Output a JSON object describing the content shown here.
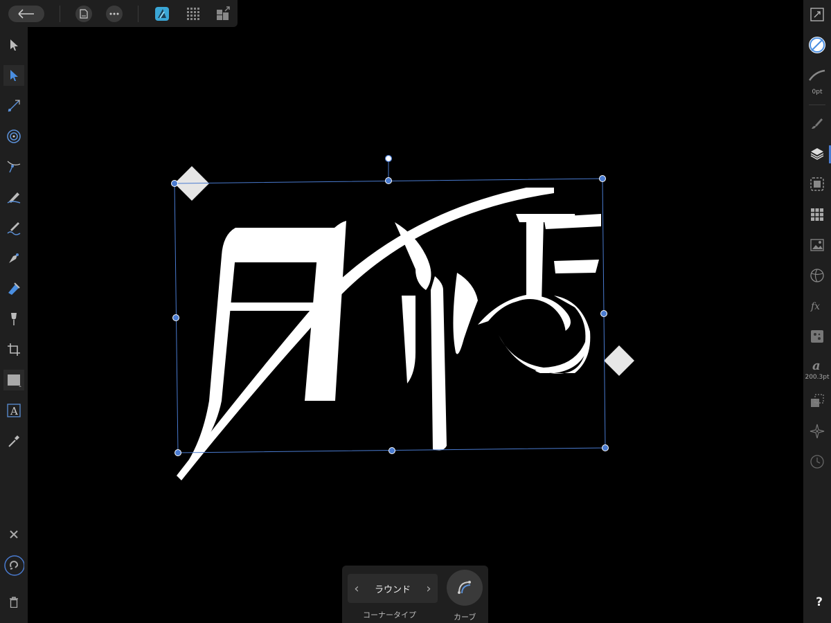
{
  "context_toolbar": {
    "corner_type_value": "ラウンド",
    "corner_type_label": "コーナータイプ",
    "curve_label": "カーブ"
  },
  "right_panel": {
    "stroke_width": "0pt",
    "font_size": "200.3pt"
  },
  "help": {
    "label": "?"
  },
  "colors": {
    "accent": "#4a7bd0",
    "affinity_blue": "#3aa6d6",
    "toolbar_bg": "#1f1f1f",
    "canvas_bg": "#000000"
  },
  "icons": {
    "top": [
      "back-arrow-icon",
      "document-icon",
      "more-icon",
      "affinity-persona-icon",
      "grid-icon",
      "export-persona-icon"
    ],
    "left": [
      "move-tool-icon",
      "node-tool-icon",
      "corner-tool-icon",
      "radial-tool-icon",
      "point-transform-icon",
      "pencil-icon",
      "vector-brush-icon",
      "pen-icon",
      "fill-tool-icon",
      "transparency-icon",
      "crop-icon",
      "rectangle-icon",
      "artistic-text-icon",
      "color-picker-icon",
      "close-icon",
      "snapping-icon",
      "trash-icon"
    ],
    "right": [
      "transform-icon",
      "color-icon",
      "stroke-icon",
      "brush-icon",
      "layers-icon",
      "appearance-icon",
      "swatches-icon",
      "image-icon",
      "adjustments-icon",
      "effects-icon",
      "styles-icon",
      "text-style-icon",
      "transform-panel-icon",
      "navigator-icon",
      "history-icon"
    ]
  }
}
